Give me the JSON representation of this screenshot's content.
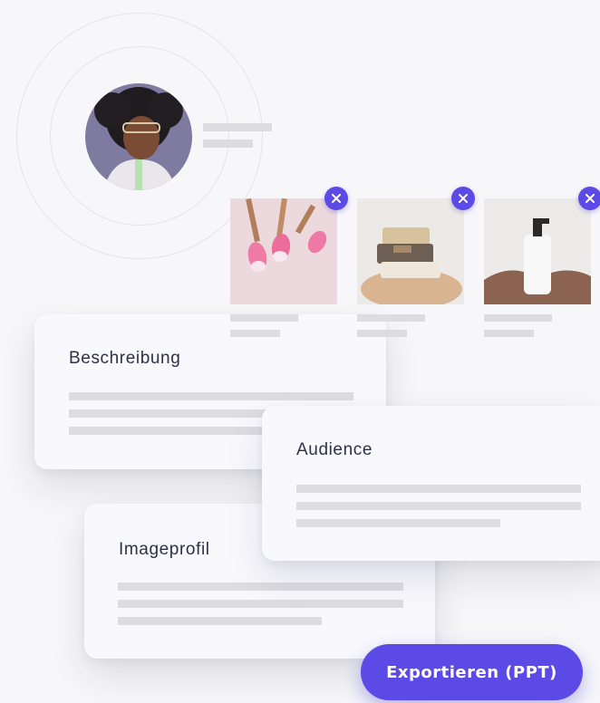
{
  "profile": {
    "avatar_icon": "person-portrait-avatar"
  },
  "media": {
    "items": [
      {
        "image": "makeup-brushes",
        "remove_icon": "close-icon"
      },
      {
        "image": "soap-bars-in-hands",
        "remove_icon": "close-icon"
      },
      {
        "image": "pump-bottle-on-fabric",
        "remove_icon": "close-icon"
      }
    ]
  },
  "cards": {
    "description_title": "Beschreibung",
    "audience_title": "Audience",
    "image_profile_title": "Imageprofil"
  },
  "actions": {
    "export_label": "Exportieren (PPT)"
  },
  "colors": {
    "accent": "#5b4ae6",
    "background": "#f7f7fa",
    "placeholder": "#dcdce1"
  }
}
